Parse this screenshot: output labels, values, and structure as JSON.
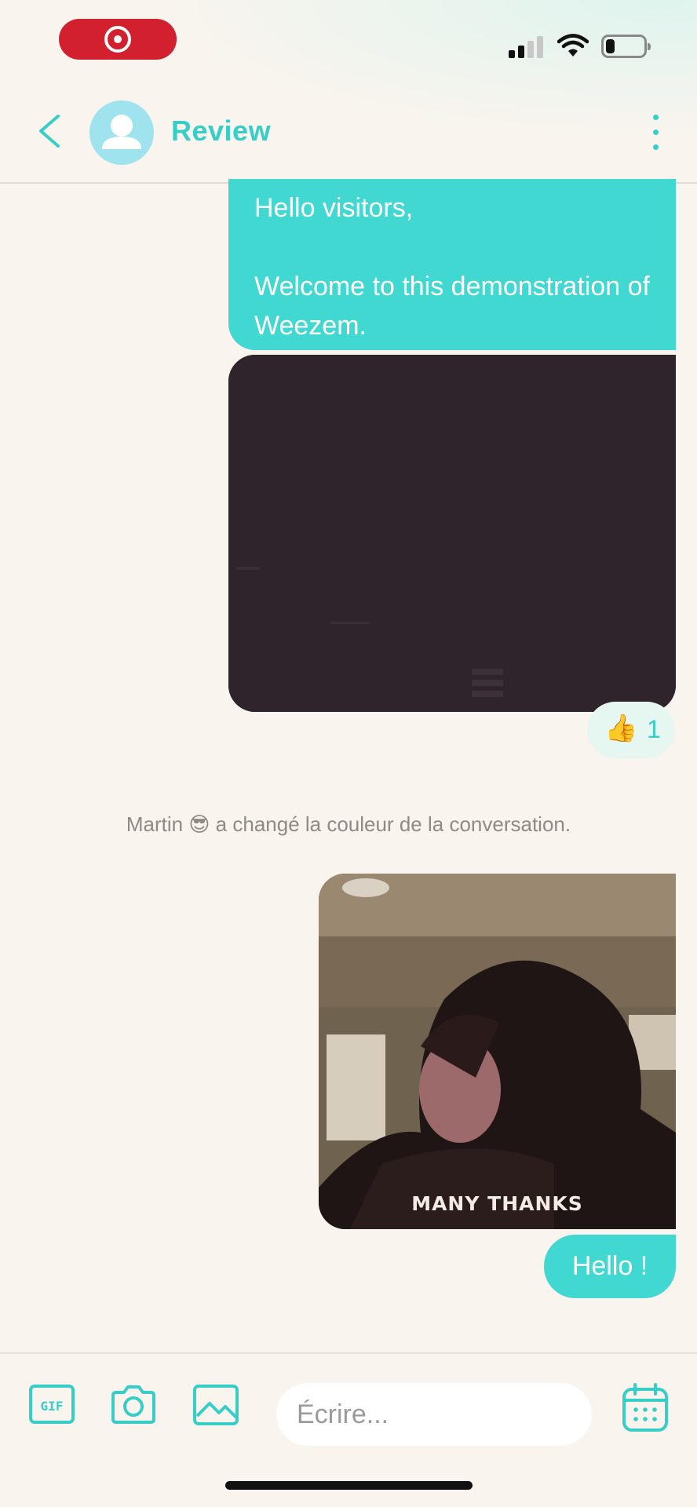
{
  "status_bar": {
    "recording_icon": "screen-record-icon",
    "signal_icon": "cellular-signal-icon",
    "wifi_icon": "wifi-icon",
    "battery_icon": "battery-icon",
    "battery_level": 0.2
  },
  "header": {
    "back_icon": "chevron-left-icon",
    "avatar_icon": "person-icon",
    "title": "Review",
    "menu_icon": "vertical-dots-icon"
  },
  "messages": {
    "first_text": "Hello visitors,\n\nWelcome to this demonstration of Weezem.",
    "video_thumbnail": "dark video preview",
    "reaction": {
      "emoji": "👍",
      "count": "1"
    },
    "system_message": "Martin 😎 a changé la couleur de la conversation.",
    "gif_caption": "MANY THANKS",
    "last_text": "Hello !"
  },
  "composer": {
    "gif_label": "GIF",
    "camera_icon": "camera-icon",
    "image_icon": "image-icon",
    "placeholder": "Écrire...",
    "calendar_icon": "calendar-icon"
  },
  "colors": {
    "accent": "#37cec8",
    "bubble": "#42d8d2",
    "record_pill": "#d2202e",
    "background": "#faf4ee"
  }
}
